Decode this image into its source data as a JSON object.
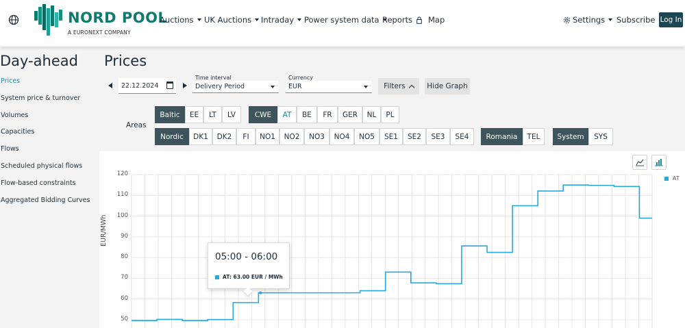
{
  "brand": {
    "name": "NORD POOL",
    "subtitle": "A EURONEXT COMPANY",
    "colors": {
      "primary": "#0f7a6e",
      "dark": "#1e4652",
      "accent": "#1b8da0",
      "series": "#29a8e0"
    }
  },
  "nav": {
    "globe_icon": "globe-icon",
    "items": [
      "Auctions",
      "UK Auctions",
      "Intraday",
      "Power system data",
      "Reports",
      "Map"
    ],
    "settings": "Settings",
    "subscribe": "Subscribe",
    "login": "Log In"
  },
  "sidebar": {
    "title": "Day-ahead",
    "items": [
      "Prices",
      "System price & turnover",
      "Volumes",
      "Capacities",
      "Flows",
      "Scheduled physical flows",
      "Flow-based constraints",
      "Aggregated Bidding Curves"
    ],
    "active_index": 0
  },
  "page": {
    "title": "Prices"
  },
  "filters": {
    "date": "22.12.2024",
    "time_interval": {
      "label": "Time interval",
      "value": "Delivery Period"
    },
    "currency": {
      "label": "Currency",
      "value": "EUR"
    },
    "filters_button": "Filters",
    "hide_graph_button": "Hide Graph"
  },
  "areas": {
    "label": "Areas",
    "row1": [
      {
        "label": "Baltic",
        "style": "dark"
      },
      {
        "label": "EE",
        "style": "plain"
      },
      {
        "label": "LT",
        "style": "plain"
      },
      {
        "label": "LV",
        "style": "plain"
      },
      {
        "label": "CWE",
        "style": "dark"
      },
      {
        "label": "AT",
        "style": "selected"
      },
      {
        "label": "BE",
        "style": "plain"
      },
      {
        "label": "FR",
        "style": "plain"
      },
      {
        "label": "GER",
        "style": "plain"
      },
      {
        "label": "NL",
        "style": "plain"
      },
      {
        "label": "PL",
        "style": "plain"
      }
    ],
    "row2": [
      {
        "label": "Nordic",
        "style": "dark"
      },
      {
        "label": "DK1",
        "style": "plain"
      },
      {
        "label": "DK2",
        "style": "plain"
      },
      {
        "label": "FI",
        "style": "plain"
      },
      {
        "label": "NO1",
        "style": "plain"
      },
      {
        "label": "NO2",
        "style": "plain"
      },
      {
        "label": "NO3",
        "style": "plain"
      },
      {
        "label": "NO4",
        "style": "plain"
      },
      {
        "label": "NO5",
        "style": "plain"
      },
      {
        "label": "SE1",
        "style": "plain"
      },
      {
        "label": "SE2",
        "style": "plain"
      },
      {
        "label": "SE3",
        "style": "plain"
      },
      {
        "label": "SE4",
        "style": "plain"
      },
      {
        "label": "Romania",
        "style": "dark"
      },
      {
        "label": "TEL",
        "style": "plain"
      },
      {
        "label": "System",
        "style": "dark"
      },
      {
        "label": "SYS",
        "style": "plain"
      }
    ]
  },
  "chart_controls": {
    "line_icon": "line-chart-icon",
    "bar_icon": "bar-chart-icon",
    "active": "bar"
  },
  "tooltip": {
    "time": "05:00 - 06:00",
    "value_text": "AT: 63.00 EUR / MWh"
  },
  "chart_data": {
    "type": "line",
    "step": true,
    "ylabel": "EUR/MWh",
    "ylim": [
      50,
      120
    ],
    "yticks": [
      50,
      60,
      70,
      80,
      90,
      100,
      110,
      120
    ],
    "grid": true,
    "legend_position": "top-right",
    "series": [
      {
        "name": "AT",
        "color": "#29a8e0",
        "values": [
          49.6,
          50.2,
          49.6,
          50.1,
          58.3,
          63.0,
          63.0,
          63.0,
          63.0,
          64.0,
          73.0,
          67.8,
          67.4,
          85.6,
          82.5,
          105.0,
          112.1,
          115.0,
          114.8,
          114.3,
          99.0
        ]
      }
    ]
  }
}
